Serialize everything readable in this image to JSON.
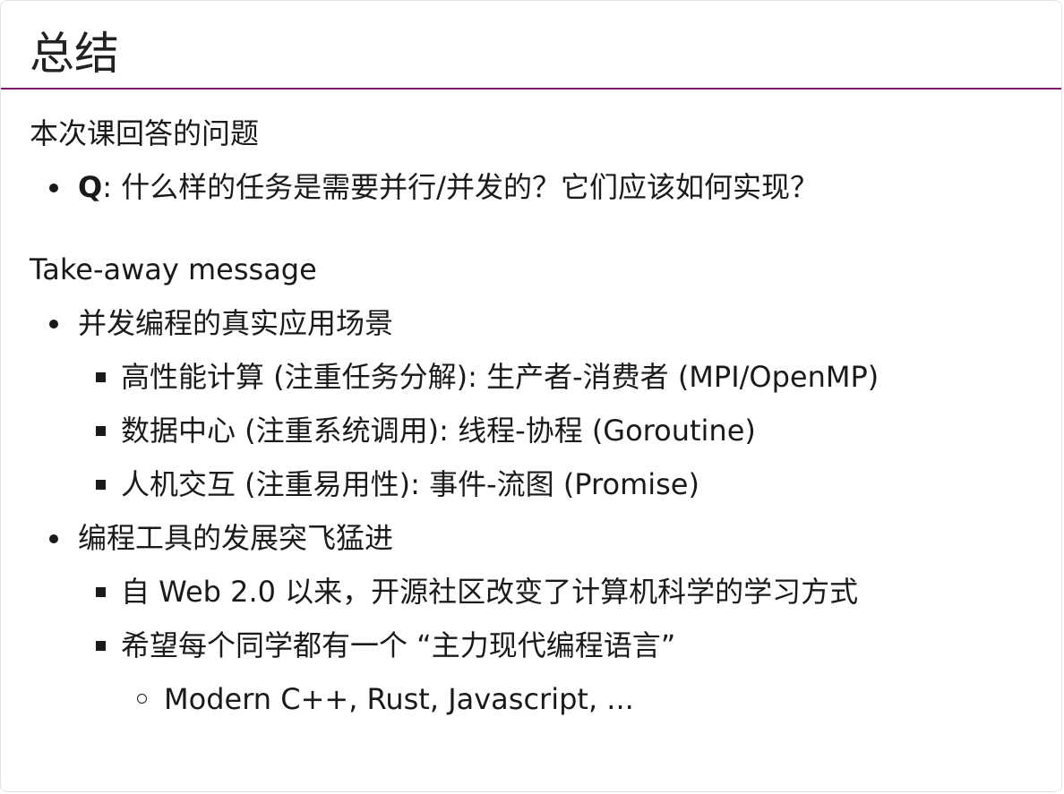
{
  "slide": {
    "title": "总结"
  },
  "section1": {
    "heading": "本次课回答的问题",
    "items": [
      {
        "label": "Q",
        "text": ": 什么样的任务是需要并行/并发的？它们应该如何实现？"
      }
    ]
  },
  "section2": {
    "heading": "Take-away message",
    "items": [
      {
        "text": "并发编程的真实应用场景",
        "children": [
          {
            "text": "高性能计算 (注重任务分解): 生产者-消费者 (MPI/OpenMP)"
          },
          {
            "text": "数据中心 (注重系统调用): 线程-协程 (Goroutine)"
          },
          {
            "text": "人机交互 (注重易用性): 事件-流图 (Promise)"
          }
        ]
      },
      {
        "text": "编程工具的发展突飞猛进",
        "children": [
          {
            "text": "自 Web 2.0 以来，开源社区改变了计算机科学的学习方式"
          },
          {
            "text": "希望每个同学都有一个 “主力现代编程语言”",
            "children": [
              {
                "text": "Modern C++, Rust, Javascript, ..."
              }
            ]
          }
        ]
      }
    ]
  }
}
